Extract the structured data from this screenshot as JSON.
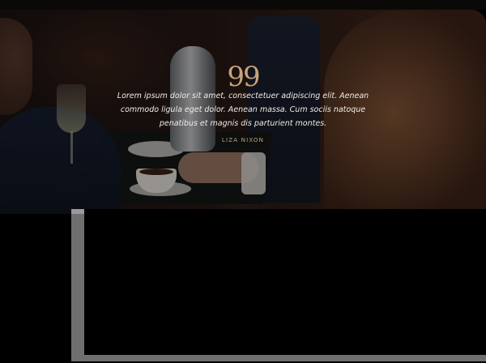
{
  "testimonial": {
    "quote_icon": "quote-icon",
    "quote_glyph": "99",
    "text": "Lorem ipsum dolor sit amet, consectetuer adipiscing elit. Aenean commodo ligula eget dolor. Aenean massa. Cum sociis natoque penatibus et magnis dis parturient montes.",
    "author": "LIZA NIXON"
  },
  "colors": {
    "accent": "#c8a47a",
    "text": "#f2ece6",
    "background": "#000000",
    "frame": "#6f6f6f"
  }
}
